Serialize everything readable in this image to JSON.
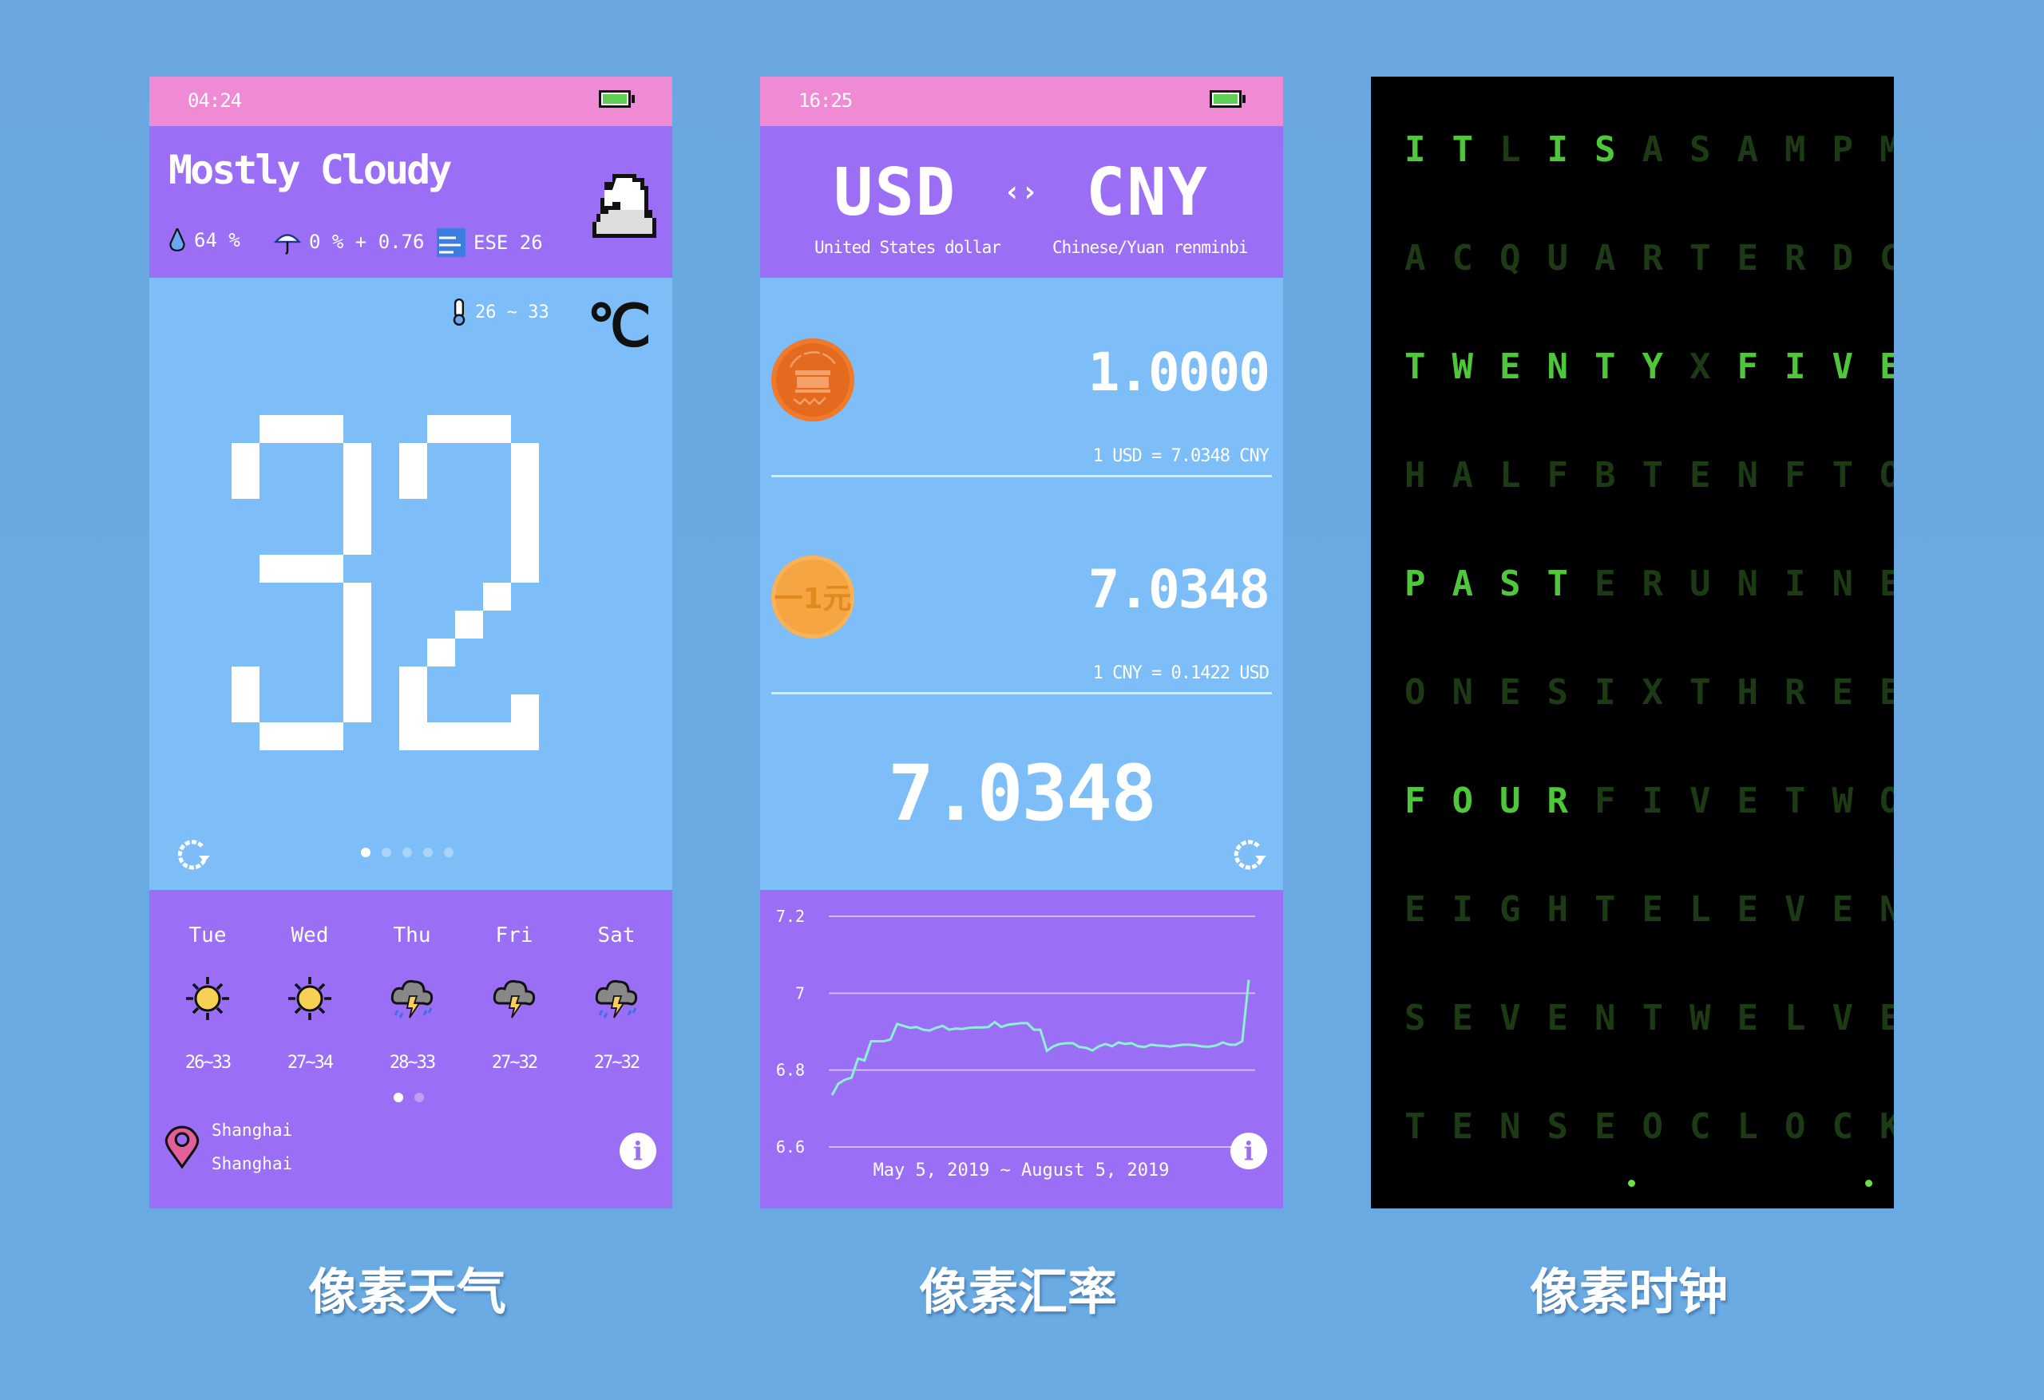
{
  "weather_app": {
    "status_time": "04:24",
    "condition": "Mostly Cloudy",
    "humidity": "64 %",
    "precipitation": "0 % + 0.76",
    "wind": "ESE 26",
    "temp_range": "26 ~ 33",
    "unit": "℃",
    "temperature": "32",
    "page_dots": {
      "count": 5,
      "active": 0
    },
    "forecast": [
      {
        "day": "Tue",
        "icon": "sun-icon",
        "range": "26~33"
      },
      {
        "day": "Wed",
        "icon": "sun-icon",
        "range": "27~34"
      },
      {
        "day": "Thu",
        "icon": "thunderstorm-rain-icon",
        "range": "28~33"
      },
      {
        "day": "Fri",
        "icon": "thunderstorm-icon",
        "range": "27~32"
      },
      {
        "day": "Sat",
        "icon": "thunderstorm-rain-icon",
        "range": "27~32"
      }
    ],
    "forecast_dots": {
      "count": 2,
      "active": 0
    },
    "location_city": "Shanghai",
    "location_region": "Shanghai",
    "caption": "像素天气"
  },
  "currency_app": {
    "status_time": "16:25",
    "from_code": "USD",
    "to_code": "CNY",
    "swap_symbol": "‹›",
    "from_name": "United States dollar",
    "to_name": "Chinese/Yuan renminbi",
    "from_amount": "1.0000",
    "from_rate": "1 USD = 7.0348 CNY",
    "to_amount": "7.0348",
    "to_rate": "1 CNY = 0.1422 USD",
    "result": "7.0348",
    "coin_cny_text": "一1元",
    "caption": "像素汇率",
    "colors": {
      "line": "#8ef0d4"
    }
  },
  "chart_data": {
    "type": "line",
    "title": "",
    "xlabel": "May 5, 2019 ~ August 5, 2019",
    "ylabel": "",
    "ylim": [
      6.6,
      7.2
    ],
    "yticks": [
      "7.2",
      "7",
      "6.8",
      "6.6"
    ],
    "grid": true,
    "series": [
      {
        "name": "USD/CNY",
        "values": [
          6.735,
          6.765,
          6.775,
          6.78,
          6.83,
          6.825,
          6.875,
          6.875,
          6.875,
          6.88,
          6.92,
          6.915,
          6.91,
          6.912,
          6.905,
          6.903,
          6.91,
          6.915,
          6.905,
          6.908,
          6.907,
          6.91,
          6.911,
          6.911,
          6.912,
          6.925,
          6.912,
          6.918,
          6.92,
          6.922,
          6.922,
          6.905,
          6.905,
          6.85,
          6.862,
          6.868,
          6.87,
          6.87,
          6.86,
          6.858,
          6.851,
          6.862,
          6.868,
          6.862,
          6.872,
          6.868,
          6.87,
          6.862,
          6.86,
          6.866,
          6.864,
          6.863,
          6.861,
          6.864,
          6.866,
          6.866,
          6.864,
          6.861,
          6.861,
          6.864,
          6.872,
          6.866,
          6.866,
          6.875,
          7.035
        ]
      }
    ]
  },
  "clock_app": {
    "rows": [
      "ITLISASAMPM",
      "ACQUARTERDC",
      "TWENTYXFIVE",
      "HALFBTENFTO",
      "PASTERUNINE",
      "ONESIXTHREE",
      "FOURFIVETWO",
      "EIGHTELEVEN",
      "SEVENTWELVE",
      "TENSEOCLOCK"
    ],
    "lit": [
      [
        0,
        1,
        3,
        4
      ],
      [],
      [
        0,
        1,
        2,
        3,
        4,
        5,
        7,
        8,
        9,
        10
      ],
      [],
      [
        0,
        1,
        2,
        3
      ],
      [],
      [
        0,
        1,
        2,
        3
      ],
      [],
      [],
      []
    ],
    "sentence": "IT IS TWENTY FIVE PAST FOUR",
    "minute_dots": 2,
    "colors": {
      "on": "#4ec83a",
      "off": "#1c3a14"
    },
    "caption": "像素时钟"
  }
}
